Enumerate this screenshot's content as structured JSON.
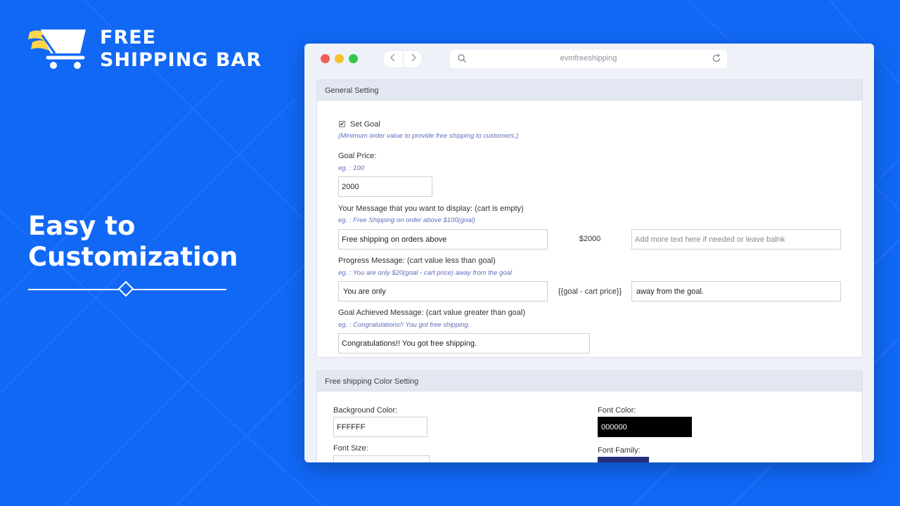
{
  "logo": {
    "line1": "FREE",
    "line2": "SHIPPING BAR"
  },
  "headline": {
    "line1": "Easy to",
    "line2": "Customization"
  },
  "browser": {
    "url": "evmfreeshipping",
    "colors": {
      "close": "#f25c54",
      "minimize": "#f7c231",
      "maximize": "#34c749"
    }
  },
  "general": {
    "title": "General Setting",
    "set_goal": {
      "label": "Set Goal",
      "checked": true,
      "hint": "(Minimum order value to provide free shipping to customers.)"
    },
    "goal_price": {
      "label": "Goal Price:",
      "hint": "eg. : 100",
      "value": "2000"
    },
    "empty_message": {
      "label": "Your Message that you want to display: (cart is empty)",
      "hint": "eg. : Free Shipping on order above $100(goal)",
      "value": "Free shipping on orders above",
      "middle": "$2000",
      "suffix_placeholder": "Add more text here if needed or leave balnk"
    },
    "progress_message": {
      "label": "Progress Message: (cart value less than goal)",
      "hint": "eg. : You are only $20(goal - cart price) away from the goal",
      "value": "You are only",
      "middle": "{{goal - cart price}}",
      "suffix": "away from the goal."
    },
    "achieved_message": {
      "label": "Goal Achieved Message: (cart value greater than goal)",
      "hint": "eg. : Congratulations!! You got free shipping.",
      "value": "Congratulations!! You got free shipping."
    }
  },
  "color_setting": {
    "title": "Free shipping Color Setting",
    "background_color": {
      "label": "Background Color:",
      "value": "FFFFFF"
    },
    "font_color": {
      "label": "Font Color:",
      "value": "000000"
    },
    "font_size": {
      "label": "Font Size:"
    },
    "font_family": {
      "label": "Font Family:"
    }
  },
  "theme": {
    "background": "#1168f5",
    "hint_color": "#5f6dba",
    "swatch_navy": "#262f7a"
  },
  "icons": [
    "cart-icon",
    "chevron-left-icon",
    "chevron-right-icon",
    "search-icon",
    "reload-icon",
    "checkbox-check-icon",
    "diamond-icon"
  ]
}
